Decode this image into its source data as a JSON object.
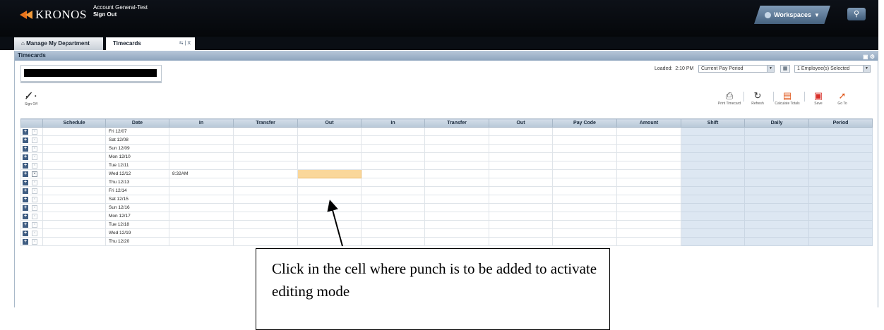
{
  "topbar": {
    "brand": "KRONOS",
    "account_name": "Account General-Test",
    "sign_out_label": "Sign Out",
    "workspaces_label": "Workspaces",
    "search_icon": "search-icon"
  },
  "tabs": [
    {
      "label": "Manage My Department",
      "icon": "home-icon"
    },
    {
      "label": "Timecards",
      "controls": "⇆ | X"
    }
  ],
  "panel": {
    "title": "Timecards",
    "loaded_label": "Loaded:",
    "loaded_time": "2:10 PM",
    "period_value": "Current Pay Period",
    "employees_value": "1 Employee(s) Selected"
  },
  "toolbar": {
    "sign_off": "Sign Off",
    "print": "Print Timecard",
    "refresh": "Refresh",
    "calc": "Calculate Totals",
    "save": "Save",
    "goto": "Go To"
  },
  "grid": {
    "columns": [
      "",
      "Schedule",
      "Date",
      "In",
      "Transfer",
      "Out",
      "In",
      "Transfer",
      "Out",
      "Pay Code",
      "Amount",
      "Shift",
      "Daily",
      "Period"
    ],
    "rows": [
      {
        "date": "Fri 12/07",
        "in": ""
      },
      {
        "date": "Sat 12/08",
        "in": ""
      },
      {
        "date": "Sun 12/09",
        "in": ""
      },
      {
        "date": "Mon 12/10",
        "in": ""
      },
      {
        "date": "Tue 12/11",
        "in": ""
      },
      {
        "date": "Wed 12/12",
        "in": "8:32AM"
      },
      {
        "date": "Thu 12/13",
        "in": ""
      },
      {
        "date": "Fri 12/14",
        "in": ""
      },
      {
        "date": "Sat 12/15",
        "in": ""
      },
      {
        "date": "Sun 12/16",
        "in": ""
      },
      {
        "date": "Mon 12/17",
        "in": ""
      },
      {
        "date": "Tue 12/18",
        "in": ""
      },
      {
        "date": "Wed 12/19",
        "in": ""
      },
      {
        "date": "Thu 12/20",
        "in": ""
      }
    ],
    "active_row": 5,
    "highlight_color": "#fad79a"
  },
  "callout": {
    "text": "Click in the cell where punch is to be added to activate editing mode"
  },
  "colors": {
    "topbar": "#05070a",
    "panel_header": "#8da4bd",
    "totals_columns": "#dde7f2",
    "accent_orange": "#e0581c"
  }
}
